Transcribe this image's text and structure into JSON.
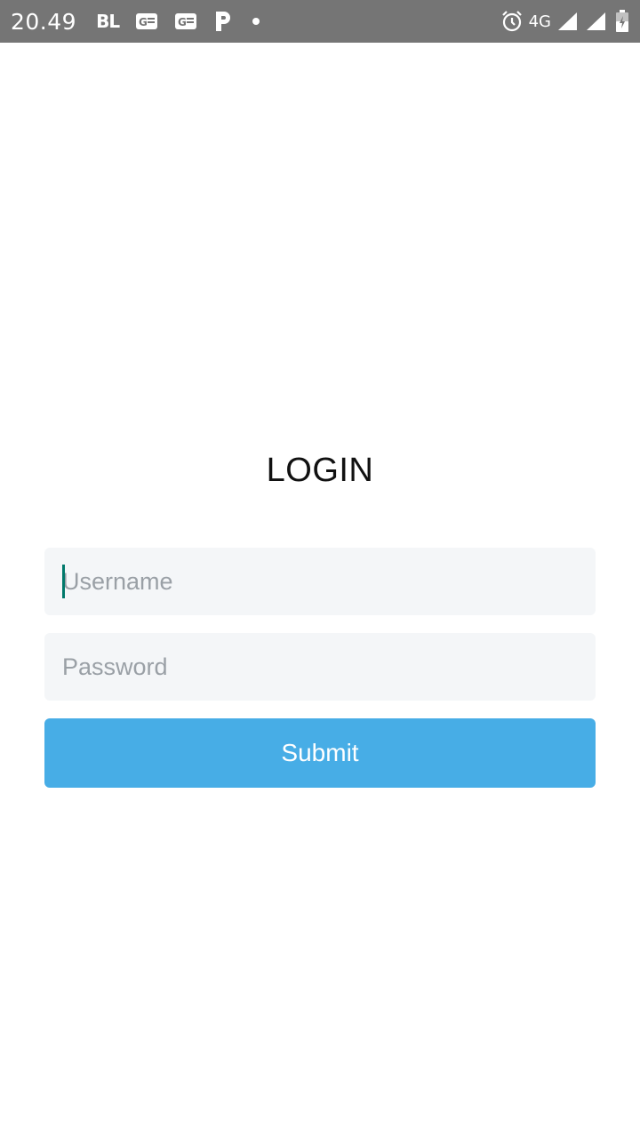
{
  "status_bar": {
    "time": "20.49",
    "notif_text": "BL",
    "network": "4G",
    "icons": [
      "gmail-icon",
      "gmail-icon",
      "p-app-icon",
      "dot-icon",
      "alarm-icon",
      "signal-icon",
      "signal-icon",
      "battery-icon"
    ]
  },
  "login": {
    "title": "LOGIN",
    "username_placeholder": "Username",
    "password_placeholder": "Password",
    "submit_label": "Submit"
  },
  "colors": {
    "status_bar_bg": "#757575",
    "field_bg": "#f4f6f8",
    "button_bg": "#47ade6",
    "caret": "#00796b"
  }
}
